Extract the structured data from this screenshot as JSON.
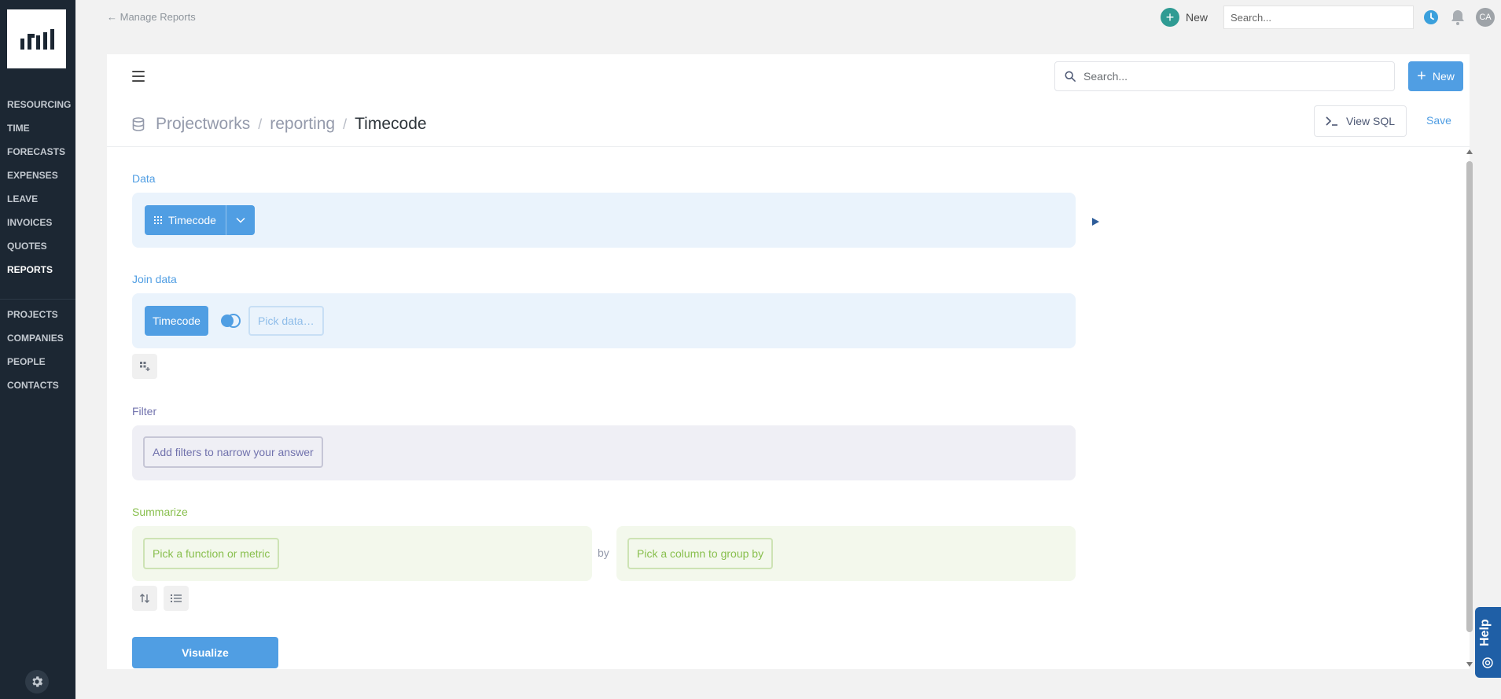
{
  "sidebar": {
    "logo_alt": "logo",
    "primary": [
      {
        "label": "RESOURCING",
        "active": false
      },
      {
        "label": "TIME",
        "active": false
      },
      {
        "label": "FORECASTS",
        "active": false
      },
      {
        "label": "EXPENSES",
        "active": false
      },
      {
        "label": "LEAVE",
        "active": false
      },
      {
        "label": "INVOICES",
        "active": false
      },
      {
        "label": "QUOTES",
        "active": false
      },
      {
        "label": "REPORTS",
        "active": true
      }
    ],
    "secondary": [
      {
        "label": "PROJECTS"
      },
      {
        "label": "COMPANIES"
      },
      {
        "label": "PEOPLE"
      },
      {
        "label": "CONTACTS"
      }
    ]
  },
  "topbar": {
    "back_label": "← Manage Reports",
    "new_label": "New",
    "search_placeholder": "Search...",
    "avatar_initials": "CA"
  },
  "editor": {
    "search_placeholder": "Search...",
    "new_label": "New",
    "breadcrumb": [
      "Projectworks",
      "reporting",
      "Timecode"
    ],
    "breadcrumb_sep": "/",
    "view_sql_label": "View SQL",
    "save_label": "Save"
  },
  "notebook": {
    "data": {
      "title": "Data",
      "table": "Timecode"
    },
    "join": {
      "title": "Join data",
      "left_table": "Timecode",
      "pick_placeholder": "Pick data…"
    },
    "filter": {
      "title": "Filter",
      "placeholder": "Add filters to narrow your answer"
    },
    "summarize": {
      "title": "Summarize",
      "metric_placeholder": "Pick a function or metric",
      "by_label": "by",
      "group_placeholder": "Pick a column to group by"
    },
    "visualize_label": "Visualize"
  },
  "help": {
    "label": "Help"
  },
  "colors": {
    "brand_blue": "#509ee3",
    "sidebar_bg": "#1c2733",
    "filter_purple": "#7172ad",
    "summarize_green": "#88bf4d",
    "help_blue": "#1f5fa6"
  }
}
